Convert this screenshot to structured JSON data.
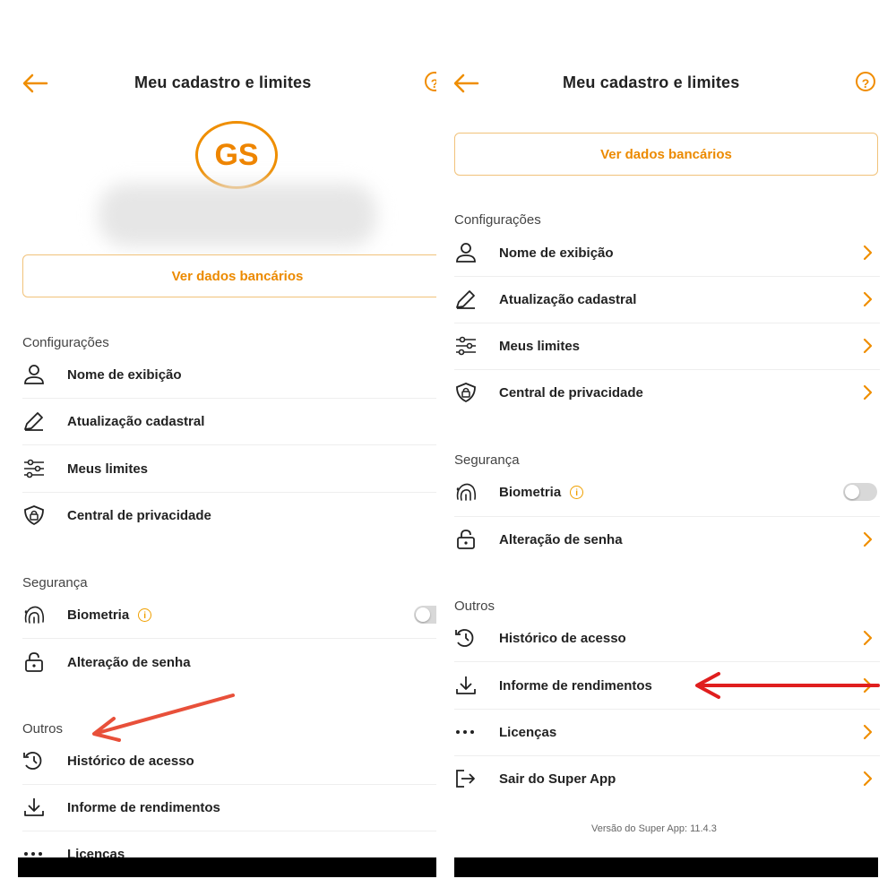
{
  "colors": {
    "accent": "#ef8e00",
    "arrow": "#e8503a",
    "arrow_right": "#e01e1e"
  },
  "left": {
    "title": "Meu cadastro e limites",
    "avatar_initials": "GS",
    "bank_button": "Ver dados bancários",
    "config_label": "Configurações",
    "config_items": [
      {
        "label": "Nome de exibição",
        "icon": "person-icon"
      },
      {
        "label": "Atualização cadastral",
        "icon": "pencil-icon"
      },
      {
        "label": "Meus limites",
        "icon": "sliders-icon"
      },
      {
        "label": "Central de privacidade",
        "icon": "shield-lock-icon"
      }
    ],
    "security_label": "Segurança",
    "biometria": "Biometria",
    "senha": "Alteração de senha",
    "outros_label": "Outros",
    "outros_items": [
      {
        "label": "Histórico de acesso",
        "icon": "history-icon"
      },
      {
        "label": "Informe de rendimentos",
        "icon": "download-icon"
      },
      {
        "label": "Licenças",
        "icon": "dots-icon"
      }
    ]
  },
  "right": {
    "title": "Meu cadastro e limites",
    "bank_button": "Ver dados bancários",
    "config_label": "Configurações",
    "config_items": [
      {
        "label": "Nome de exibição",
        "icon": "person-icon"
      },
      {
        "label": "Atualização cadastral",
        "icon": "pencil-icon"
      },
      {
        "label": "Meus limites",
        "icon": "sliders-icon"
      },
      {
        "label": "Central de privacidade",
        "icon": "shield-lock-icon"
      }
    ],
    "security_label": "Segurança",
    "biometria": "Biometria",
    "senha": "Alteração de senha",
    "outros_label": "Outros",
    "outros_items": [
      {
        "label": "Histórico de acesso",
        "icon": "history-icon"
      },
      {
        "label": "Informe de rendimentos",
        "icon": "download-icon"
      },
      {
        "label": "Licenças",
        "icon": "dots-icon"
      },
      {
        "label": "Sair do Super App",
        "icon": "logout-icon"
      }
    ],
    "version": "Versão do Super App: 11.4.3"
  }
}
